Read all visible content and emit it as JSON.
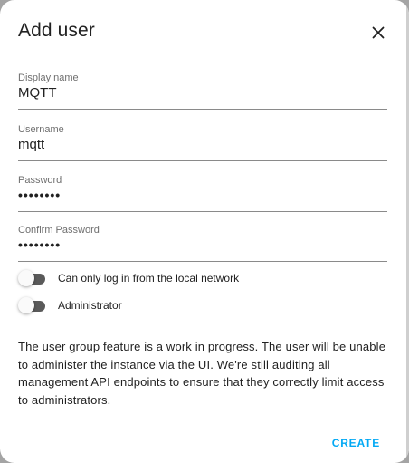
{
  "dialog": {
    "title": "Add user",
    "close_icon": "close-icon"
  },
  "fields": {
    "display_name": {
      "label": "Display name",
      "value": "MQTT"
    },
    "username": {
      "label": "Username",
      "value": "mqtt"
    },
    "password": {
      "label": "Password",
      "value": "••••••••"
    },
    "confirm_password": {
      "label": "Confirm Password",
      "value": "••••••••"
    }
  },
  "toggles": {
    "local_only": {
      "label": "Can only log in from the local network",
      "checked": false
    },
    "administrator": {
      "label": "Administrator",
      "checked": false
    }
  },
  "info": {
    "text": "The user group feature is a work in progress. The user will be unable to administer the instance via the UI. We're still auditing all management API endpoints to ensure that they correctly limit access to administrators."
  },
  "actions": {
    "create_label": "CREATE"
  },
  "colors": {
    "accent": "#03a9f4",
    "toggle_track": "#5a5a5a",
    "divider": "#8a8a8a"
  }
}
